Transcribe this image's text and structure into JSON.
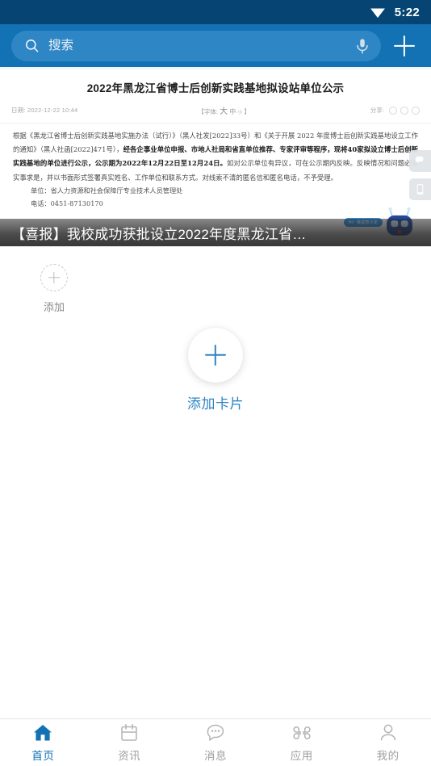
{
  "status_bar": {
    "wifi_icon": "wifi-icon",
    "time": "5:22"
  },
  "header": {
    "search": {
      "icon": "search-icon",
      "placeholder": "搜索",
      "value": "",
      "mic_icon": "microphone-icon"
    },
    "add_icon": "plus-icon",
    "background_color": "#1272b4"
  },
  "news_card": {
    "article_title": "2022年黑龙江省博士后创新实践基地拟设站单位公示",
    "meta": {
      "date_label": "日期:",
      "date_value": "2022-12-22 10:44",
      "font_label": "【字体:",
      "font_large": "大",
      "font_medium": "中",
      "font_small": "小",
      "font_label_end": "】",
      "share_label": "分享:",
      "share_icons": [
        "share-circle-icon-1",
        "share-circle-icon-2",
        "share-circle-icon-3"
      ]
    },
    "body_paragraph_1": "根据《黑龙江省博士后创新实践基地实施办法（试行）》（黑人社发[2022]33号）和《关于开展 2022 年度博士后创新实践基地设立工作的通知》（黑人社函[2022]471号），",
    "body_bold_1": "经各企事业单位申报、市地人社局和省直单位推荐、专家评审等程序，现将40家拟设立博士后创新实践基地的单位进行公示，公示期为2022年12月22日至12月24日。",
    "body_paragraph_2": "如对公示单位有异议，可在公示期内反映。反映情况和问题必须实事求是，并以书面形式签署真实姓名、工作单位和联系方式。对线索不清的匿名信和匿名电话，不予受理。",
    "signature_unit": "单位：省人力资源和社会保障厅专业技术人员管理处",
    "signature_phone": "电话：0451-87130170",
    "page_dots": 6,
    "side_buttons": [
      {
        "name": "comment-bubble-icon"
      },
      {
        "name": "mobile-device-icon"
      }
    ],
    "mascot": {
      "icon": "robot-mascot-icon",
      "tag_text": "Hi！我是智小龙"
    },
    "banner_headline": "【喜报】我校成功获批设立2022年度黑龙江省…"
  },
  "main": {
    "add_shortcut": {
      "icon": "plus-icon",
      "label": "添加"
    },
    "add_card": {
      "icon": "plus-icon",
      "label": "添加卡片",
      "accent_color": "#2f84c4"
    }
  },
  "tabbar": {
    "active_color": "#1272b4",
    "inactive_color": "#a0a0a0",
    "items": [
      {
        "label": "首页",
        "icon": "home-icon",
        "active": true
      },
      {
        "label": "资讯",
        "icon": "news-icon",
        "active": false
      },
      {
        "label": "消息",
        "icon": "message-icon",
        "active": false
      },
      {
        "label": "应用",
        "icon": "apps-icon",
        "active": false
      },
      {
        "label": "我的",
        "icon": "profile-icon",
        "active": false
      }
    ]
  }
}
